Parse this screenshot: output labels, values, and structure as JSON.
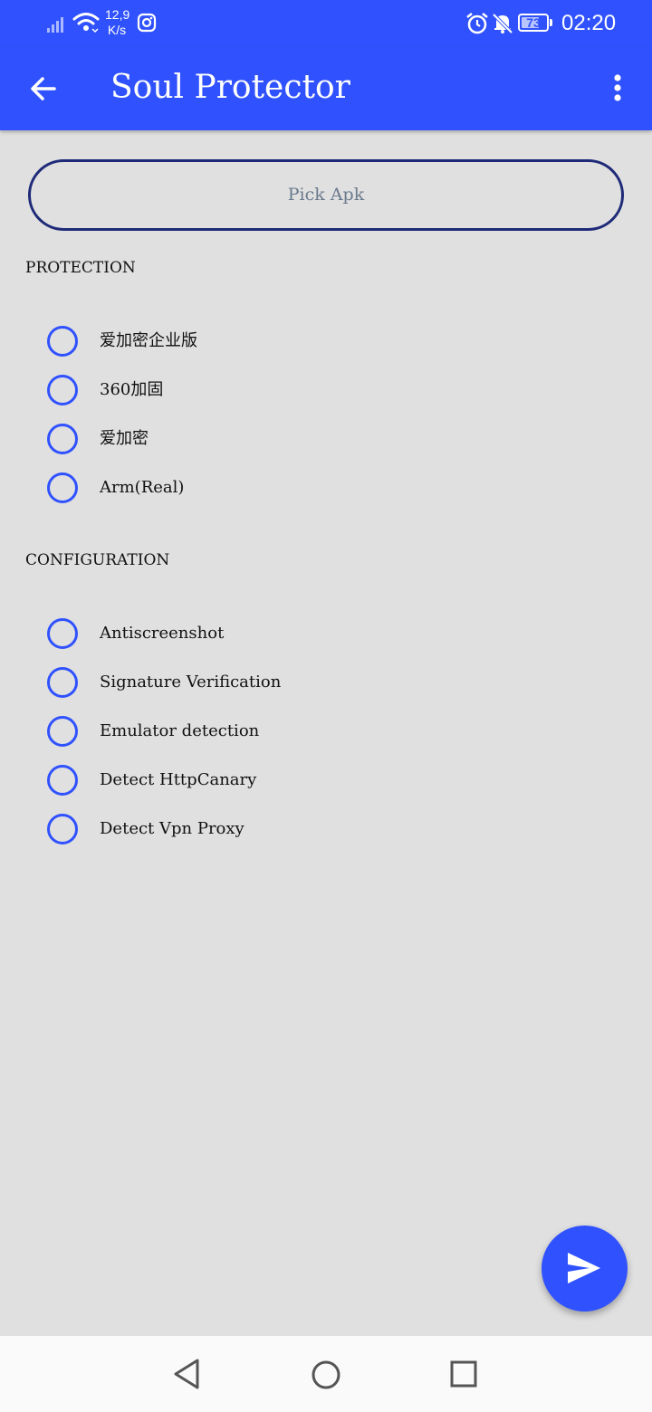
{
  "status_bar": {
    "network_speed_value": "12,9",
    "network_speed_unit": "K/s",
    "battery_level": "73",
    "time": "02:20"
  },
  "app_bar": {
    "title": "Soul Protector",
    "accent_color": "#3052fe"
  },
  "pick_button": {
    "label": "Pick Apk"
  },
  "protection": {
    "title": "PROTECTION",
    "options": [
      {
        "label": "爱加密企业版",
        "selected": false
      },
      {
        "label": "360加固",
        "selected": false
      },
      {
        "label": "爱加密",
        "selected": false
      },
      {
        "label": "Arm(Real)",
        "selected": false
      }
    ]
  },
  "configuration": {
    "title": "CONFIGURATION",
    "options": [
      {
        "label": "Antiscreenshot",
        "selected": false
      },
      {
        "label": "Signature Verification",
        "selected": false
      },
      {
        "label": "Emulator detection",
        "selected": false
      },
      {
        "label": "Detect HttpCanary",
        "selected": false
      },
      {
        "label": "Detect Vpn Proxy",
        "selected": false
      }
    ]
  },
  "fab": {
    "icon": "send-icon"
  },
  "nav_bar": {
    "icons": [
      "nav-back-icon",
      "nav-home-icon",
      "nav-recents-icon"
    ]
  }
}
